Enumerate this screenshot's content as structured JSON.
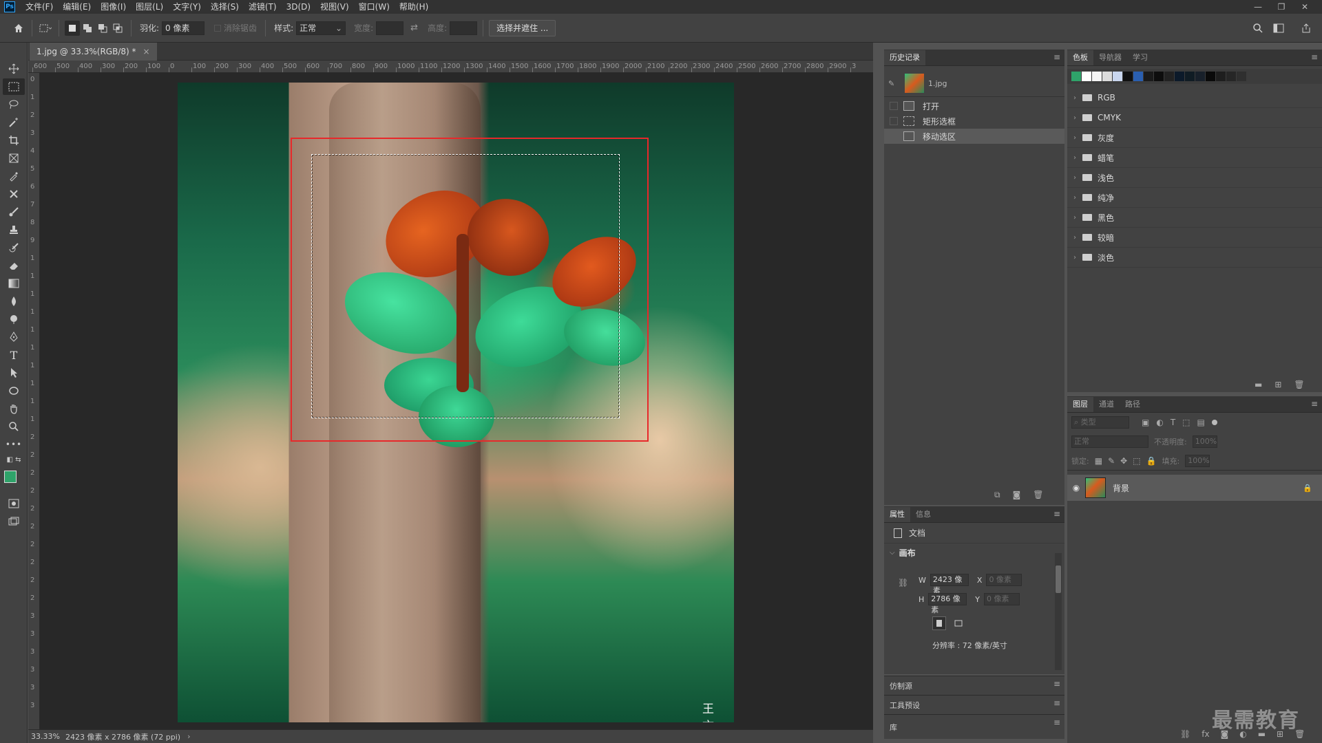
{
  "menubar": {
    "logo": "Ps",
    "items": [
      "文件(F)",
      "编辑(E)",
      "图像(I)",
      "图层(L)",
      "文字(Y)",
      "选择(S)",
      "滤镜(T)",
      "3D(D)",
      "视图(V)",
      "窗口(W)",
      "帮助(H)"
    ]
  },
  "options": {
    "feather_label": "羽化:",
    "feather_value": "0 像素",
    "antialias_label": "消除锯齿",
    "style_label": "样式:",
    "style_value": "正常",
    "width_label": "宽度:",
    "height_label": "高度:",
    "select_mask_button": "选择并遮住 ..."
  },
  "document": {
    "tab_title": "1.jpg @ 33.3%(RGB/8) *",
    "close_glyph": "×",
    "photo_signature": "王文王君"
  },
  "ruler": {
    "h_ticks": [
      "600",
      "500",
      "400",
      "300",
      "200",
      "100",
      "0",
      "100",
      "200",
      "300",
      "400",
      "500",
      "600",
      "700",
      "800",
      "900",
      "1000",
      "1100",
      "1200",
      "1300",
      "1400",
      "1500",
      "1600",
      "1700",
      "1800",
      "1900",
      "2000",
      "2100",
      "2200",
      "2300",
      "2400",
      "2500",
      "2600",
      "2700",
      "2800",
      "2900",
      "3"
    ],
    "v_ticks": [
      "0",
      "1",
      "2",
      "3",
      "4",
      "5",
      "6",
      "7",
      "8",
      "9",
      "1",
      "1",
      "1",
      "1",
      "1",
      "1",
      "1",
      "1",
      "1",
      "1",
      "2",
      "2",
      "2",
      "2",
      "2",
      "2",
      "2",
      "2",
      "2",
      "2",
      "3",
      "3",
      "3",
      "3",
      "3",
      "3"
    ]
  },
  "status": {
    "zoom": "33.33%",
    "doc_info": "2423 像素 x 2786 像素 (72 ppi)",
    "arrow": "›"
  },
  "history": {
    "tab": "历史记录",
    "snapshot": "1.jpg",
    "items": [
      {
        "label": "打开"
      },
      {
        "label": "矩形选框"
      },
      {
        "label": "移动选区"
      }
    ]
  },
  "properties": {
    "tabs": [
      "属性",
      "信息"
    ],
    "doc_label": "文档",
    "section": "画布",
    "w_label": "W",
    "w_value": "2423 像素",
    "h_label": "H",
    "h_value": "2786 像素",
    "x_label": "X",
    "x_value": "0 像素",
    "y_label": "Y",
    "y_value": "0 像素",
    "resolution": "分辨率 : 72 像素/英寸"
  },
  "collapsed_panels": [
    "仿制源",
    "工具预设",
    "库"
  ],
  "swatches": {
    "tabs": [
      "色板",
      "导航器",
      "学习"
    ],
    "colors": [
      "#2fa36a",
      "#ffffff",
      "#f4f4f4",
      "#dcdcdc",
      "#c9d6ee",
      "#101010",
      "#2a5fb0",
      "#1a1a1a",
      "#0d0d0d",
      "#222222",
      "#0c1a2a",
      "#101c24",
      "#18202a",
      "#0a0a0a",
      "#1e1e1e",
      "#262626",
      "#2f2f2f"
    ],
    "folders": [
      "RGB",
      "CMYK",
      "灰度",
      "蜡笔",
      "浅色",
      "纯净",
      "黑色",
      "较暗",
      "淡色"
    ]
  },
  "layers": {
    "tabs": [
      "图层",
      "通道",
      "路径"
    ],
    "filter_placeholder": "类型",
    "blend_mode": "正常",
    "opacity_label": "不透明度:",
    "opacity_value": "100%",
    "lock_label": "锁定:",
    "fill_label": "填充:",
    "fill_value": "100%",
    "items": [
      {
        "name": "背景"
      }
    ]
  },
  "site_watermark": "最需教育"
}
